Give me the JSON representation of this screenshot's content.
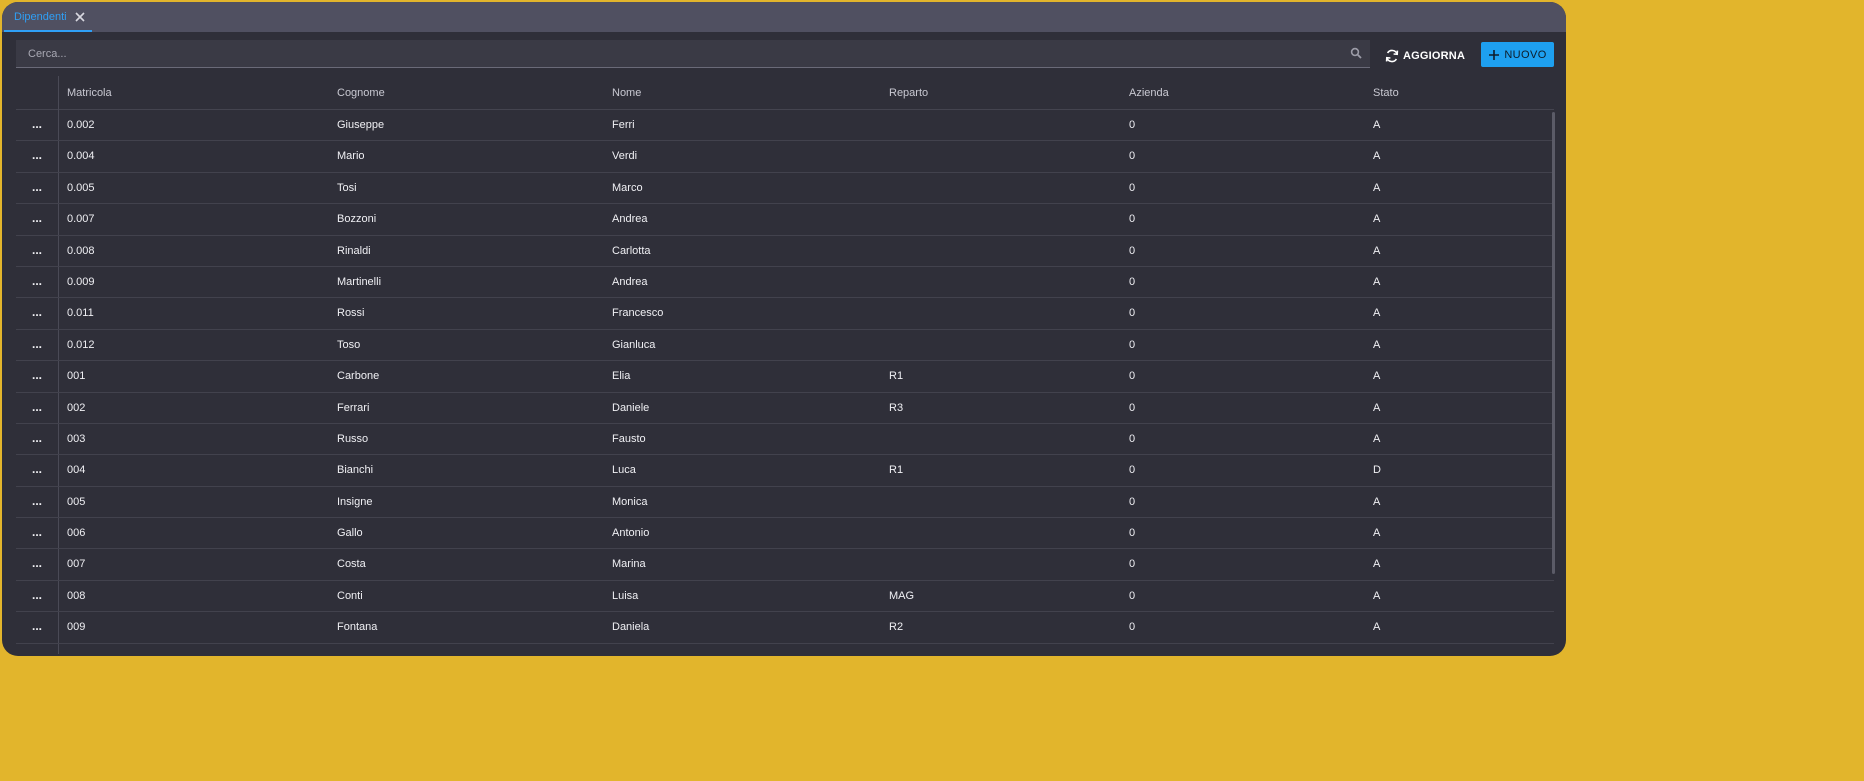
{
  "tab": {
    "label": "Dipendenti"
  },
  "search": {
    "placeholder": "Cerca..."
  },
  "toolbar": {
    "refresh_label": "AGGIORNA",
    "new_label": "NUOVO"
  },
  "colors": {
    "accent": "#1ea0f0",
    "tab_accent": "#2f9ff5",
    "background": "#2f2f39",
    "frame": "#e2b52c"
  },
  "icons": {
    "close": "close-icon",
    "search": "search-icon",
    "refresh": "refresh-icon",
    "new": "plus-icon"
  },
  "grid": {
    "row_menu_label": "...",
    "columns": [
      "Matricola",
      "Cognome",
      "Nome",
      "Reparto",
      "Azienda",
      "Stato"
    ],
    "rows": [
      [
        "0.002",
        "Giuseppe",
        "Ferri",
        "",
        "0",
        "A"
      ],
      [
        "0.004",
        "Mario",
        "Verdi",
        "",
        "0",
        "A"
      ],
      [
        "0.005",
        "Tosi",
        "Marco",
        "",
        "0",
        "A"
      ],
      [
        "0.007",
        "Bozzoni",
        "Andrea",
        "",
        "0",
        "A"
      ],
      [
        "0.008",
        "Rinaldi",
        "Carlotta",
        "",
        "0",
        "A"
      ],
      [
        "0.009",
        "Martinelli",
        "Andrea",
        "",
        "0",
        "A"
      ],
      [
        "0.011",
        "Rossi",
        "Francesco",
        "",
        "0",
        "A"
      ],
      [
        "0.012",
        "Toso",
        "Gianluca",
        "",
        "0",
        "A"
      ],
      [
        "001",
        "Carbone",
        "Elia",
        "R1",
        "0",
        "A"
      ],
      [
        "002",
        "Ferrari",
        "Daniele",
        "R3",
        "0",
        "A"
      ],
      [
        "003",
        "Russo",
        "Fausto",
        "",
        "0",
        "A"
      ],
      [
        "004",
        "Bianchi",
        "Luca",
        "R1",
        "0",
        "D"
      ],
      [
        "005",
        "Insigne",
        "Monica",
        "",
        "0",
        "A"
      ],
      [
        "006",
        "Gallo",
        "Antonio",
        "",
        "0",
        "A"
      ],
      [
        "007",
        "Costa",
        "Marina",
        "",
        "0",
        "A"
      ],
      [
        "008",
        "Conti",
        "Luisa",
        "MAG",
        "0",
        "A"
      ],
      [
        "009",
        "Fontana",
        "Daniela",
        "R2",
        "0",
        "A"
      ]
    ]
  }
}
